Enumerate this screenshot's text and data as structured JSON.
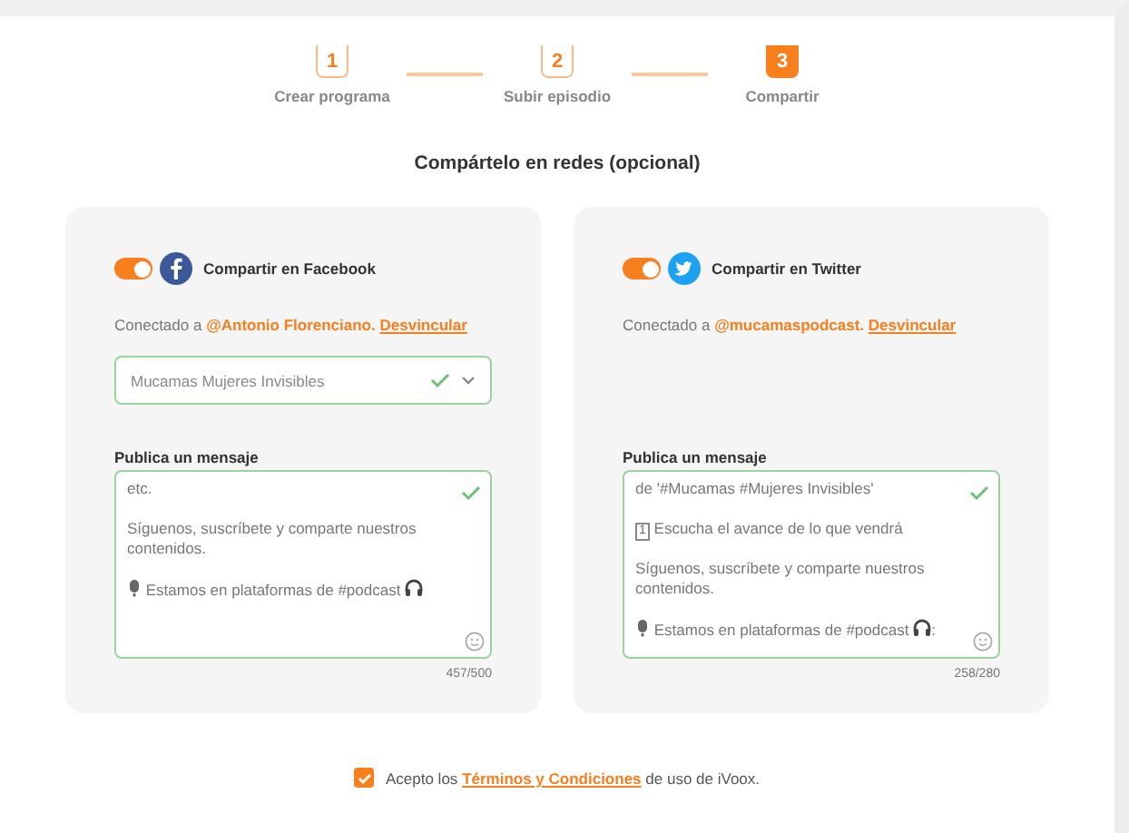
{
  "steps": [
    {
      "number": "1",
      "label": "Crear programa",
      "selected": false
    },
    {
      "number": "2",
      "label": "Subir episodio",
      "selected": false
    },
    {
      "number": "3",
      "label": "Compartir",
      "selected": true
    }
  ],
  "title": "Compártelo en redes (opcional)",
  "panels": [
    {
      "kind": "facebook",
      "enabled": true,
      "share_label": "Compartir en Facebook",
      "connected_prefix": "Conectado a",
      "account": "@Antonio Florenciano.",
      "unlink": "Desvincular",
      "page_select": {
        "value": "Mucamas Mujeres Invisibles",
        "valid": true
      },
      "message_label": "Publica un mensaje",
      "message_valid": true,
      "paragraphs": [
        {
          "kind": "plain",
          "text": "etc."
        },
        {
          "kind": "plain",
          "text": "Síguenos, suscríbete y comparte nuestros contenidos."
        },
        {
          "kind": "promo",
          "text": "Estamos en plataformas de #podcast"
        }
      ],
      "counter": "457/500"
    },
    {
      "kind": "twitter",
      "enabled": true,
      "share_label": "Compartir en Twitter",
      "connected_prefix": "Conectado a",
      "account": "@mucamaspodcast.",
      "unlink": "Desvincular",
      "message_label": "Publica un mensaje",
      "message_valid": true,
      "paragraphs": [
        {
          "kind": "plain",
          "text": "de '#Mucamas #Mujeres Invisibles'"
        },
        {
          "kind": "numbered",
          "number": "1",
          "text": "Escucha  el avance de lo que vendrá"
        },
        {
          "kind": "plain",
          "text": "Síguenos, suscríbete y comparte nuestros contenidos."
        },
        {
          "kind": "promo",
          "text": "Estamos en plataformas de #podcast",
          "suffix": ":"
        }
      ],
      "counter": "258/280"
    }
  ],
  "terms": {
    "checked": true,
    "prefix": "Acepto los",
    "link": "Términos y Condiciones",
    "suffix": "de uso de iVoox."
  }
}
